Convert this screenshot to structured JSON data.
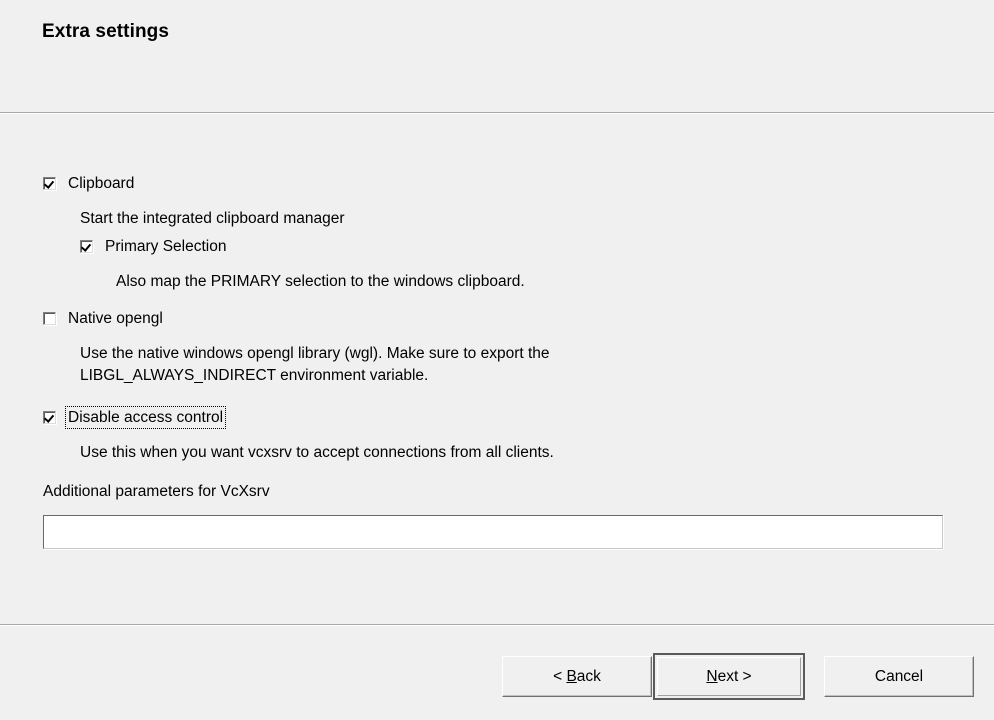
{
  "page": {
    "title": "Extra settings"
  },
  "options": [
    {
      "name": "clipboard",
      "label": "Clipboard",
      "checked": true,
      "description": "Start the integrated clipboard manager"
    },
    {
      "name": "primary-selection",
      "label": "Primary Selection",
      "checked": true,
      "description": "Also map the PRIMARY selection to the windows clipboard."
    },
    {
      "name": "native-opengl",
      "label": "Native opengl",
      "checked": false,
      "description": "Use the native windows opengl library (wgl). Make sure to export the\nLIBGL_ALWAYS_INDIRECT environment variable."
    },
    {
      "name": "disable-access-control",
      "label": "Disable access control",
      "checked": true,
      "focused": true,
      "description": "Use this when you want vcxsrv to accept connections from all clients."
    }
  ],
  "additional_parameters": {
    "label": "Additional parameters for VcXsrv",
    "value": "",
    "placeholder": ""
  },
  "buttons": {
    "back": {
      "prefix": "< ",
      "accel": "B",
      "suffix": "ack"
    },
    "next": {
      "prefix": "",
      "accel": "N",
      "suffix": "ext >"
    },
    "cancel": {
      "label": "Cancel"
    }
  },
  "colors": {
    "background": "#f0f0f0",
    "text": "#000000",
    "rule": "#a8a8a8",
    "field_background": "#ffffff",
    "default_button_border": "#5a5a5a"
  }
}
